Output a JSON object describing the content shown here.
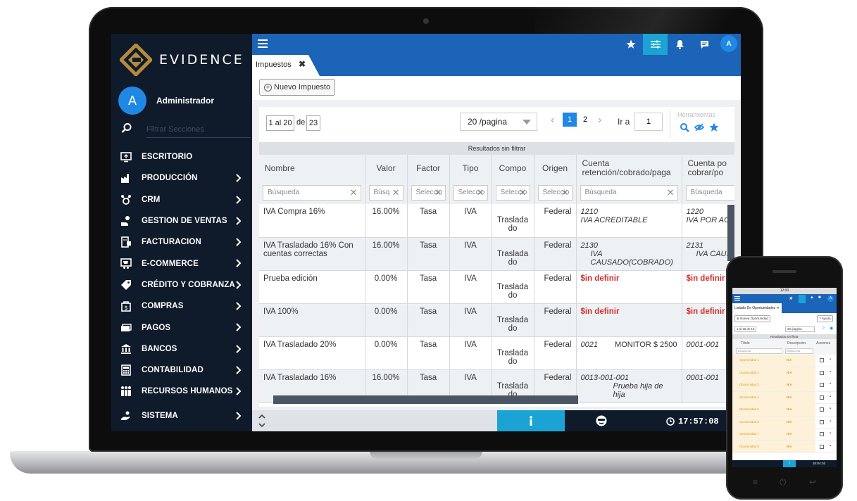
{
  "brand": {
    "name": "EVIDENCE",
    "gold": "#b58a3c"
  },
  "user": {
    "initial": "A",
    "name": "Administrador"
  },
  "sidebar": {
    "filter_placeholder": "Filtrar Secciones",
    "items": [
      {
        "label": "ESCRITORIO",
        "icon": "desktop-icon",
        "chevron": false
      },
      {
        "label": "PRODUCCIÓN",
        "icon": "production-icon",
        "chevron": true
      },
      {
        "label": "CRM",
        "icon": "crm-icon",
        "chevron": true
      },
      {
        "label": "GESTION DE VENTAS",
        "icon": "sales-icon",
        "chevron": true
      },
      {
        "label": "FACTURACION",
        "icon": "invoice-icon",
        "chevron": true
      },
      {
        "label": "E-COMMERCE",
        "icon": "ecommerce-icon",
        "chevron": true
      },
      {
        "label": "CRÉDITO Y COBRANZA",
        "icon": "credit-icon",
        "chevron": true
      },
      {
        "label": "COMPRAS",
        "icon": "purchases-icon",
        "chevron": true
      },
      {
        "label": "PAGOS",
        "icon": "payments-icon",
        "chevron": true
      },
      {
        "label": "BANCOS",
        "icon": "bank-icon",
        "chevron": true
      },
      {
        "label": "CONTABILIDAD",
        "icon": "calculator-icon",
        "chevron": true
      },
      {
        "label": "RECURSOS HUMANOS",
        "icon": "people-icon",
        "chevron": true
      },
      {
        "label": "SISTEMA",
        "icon": "system-icon",
        "chevron": true
      }
    ]
  },
  "topbar": {
    "avatar": "A",
    "colors": {
      "bar": "#1b64b7",
      "active": "#1aa3d4"
    }
  },
  "tab": {
    "label": "Impuestos",
    "close": "✖"
  },
  "actions": {
    "new_label": "Nuevo Impuesto"
  },
  "pager": {
    "range": "1 al 20",
    "of": "de",
    "total": "23",
    "per_page": "20 /pagina",
    "pages": [
      "1",
      "2"
    ],
    "current_page": "1",
    "goto_label": "Ir a",
    "goto_value": "1",
    "tools_label": "Herramientas"
  },
  "results_label": "Resultados sin filtrar",
  "table": {
    "columns": [
      "Nombre",
      "Valor",
      "Factor",
      "Tipo",
      "Compo",
      "Origen",
      "Cuenta retención/cobrado/paga",
      "Cuenta po cobrar/po"
    ],
    "filters": [
      "Búsqueda",
      "Búsq",
      "Seleccio",
      "Seleccio",
      "Seleccio",
      "Seleccio",
      "Búsqueda",
      "Búsqueda"
    ],
    "rows": [
      {
        "nombre": "IVA Compra 16%",
        "valor": "16.00%",
        "factor": "Tasa",
        "tipo": "IVA",
        "compo": "Traslada do",
        "origen": "Federal",
        "cuenta1_code": "1210",
        "cuenta1_name": "IVA ACREDITABLE",
        "cuenta1_extra": "",
        "cuenta2_code": "1220",
        "cuenta2_name": "IVA POR ACR",
        "undefined": false
      },
      {
        "nombre": "IVA Trasladado 16% Con cuentas correctas",
        "valor": "16.00%",
        "factor": "Tasa",
        "tipo": "IVA",
        "compo": "Traslada do",
        "origen": "Federal",
        "cuenta1_code": "2130",
        "cuenta1_name": "IVA CAUSADO(COBRADO)",
        "cuenta1_extra": "",
        "cuenta2_code": "2131",
        "cuenta2_name": "IVA CAUS",
        "undefined": false
      },
      {
        "nombre": "Prueba edición",
        "valor": "0.00%",
        "factor": "Tasa",
        "tipo": "IVA",
        "compo": "Traslada do",
        "origen": "Federal",
        "cuenta1_code": "$in definir",
        "cuenta1_name": "",
        "cuenta1_extra": "",
        "cuenta2_code": "$in definir",
        "cuenta2_name": "",
        "undefined": true
      },
      {
        "nombre": "IVA 100%",
        "valor": "0.00%",
        "factor": "Tasa",
        "tipo": "IVA",
        "compo": "Traslada do",
        "origen": "Federal",
        "cuenta1_code": "$in definir",
        "cuenta1_name": "",
        "cuenta1_extra": "",
        "cuenta2_code": "$in definir",
        "cuenta2_name": "",
        "undefined": true
      },
      {
        "nombre": "IVA Trasladado 20%",
        "valor": "0.00%",
        "factor": "Tasa",
        "tipo": "IVA",
        "compo": "Traslada do",
        "origen": "Federal",
        "cuenta1_code": "0021",
        "cuenta1_name": "",
        "cuenta1_extra": "MONITOR $ 2500",
        "cuenta2_code": "0001-001",
        "cuenta2_name": "",
        "undefined": false
      },
      {
        "nombre": "IVA Trasladado 16%",
        "valor": "16.00%",
        "factor": "Tasa",
        "tipo": "IVA",
        "compo": "Traslada do",
        "origen": "Federal",
        "cuenta1_code": "0013-001-001",
        "cuenta1_name": "Prueba hija de hija",
        "cuenta1_extra": "",
        "cuenta2_code": "0001-001",
        "cuenta2_name": "",
        "undefined": false
      }
    ]
  },
  "statusbar": {
    "time": "17:57:08"
  },
  "phone": {
    "status_time": "12:00",
    "tab_label": "Listado De Oportunidades",
    "new_label": "Nueva Oportunidad",
    "help_label": "Ayuda",
    "range": "1 al 15 de 16",
    "per_page": "20 /pagina",
    "results_label": "Resultados sin filtrar",
    "columns": [
      "Título",
      "Descripción",
      "Acciones"
    ],
    "filter_placeholder": "Búsqueda",
    "rows": [
      {
        "title": "Oportunidad 1",
        "desc": "N/A"
      },
      {
        "title": "Oportunidad 2",
        "desc": "N/A"
      },
      {
        "title": "Oportunidad 3",
        "desc": "N/A"
      },
      {
        "title": "Oportunidad 4",
        "desc": "N/A"
      },
      {
        "title": "Oportunidad 5",
        "desc": "N/A"
      },
      {
        "title": "Oportunidad 6",
        "desc": "N/A"
      },
      {
        "title": "Oportunidad 7",
        "desc": "N/A"
      },
      {
        "title": "Oportunidad 8",
        "desc": "N/A"
      }
    ],
    "time": "10:04:16"
  }
}
